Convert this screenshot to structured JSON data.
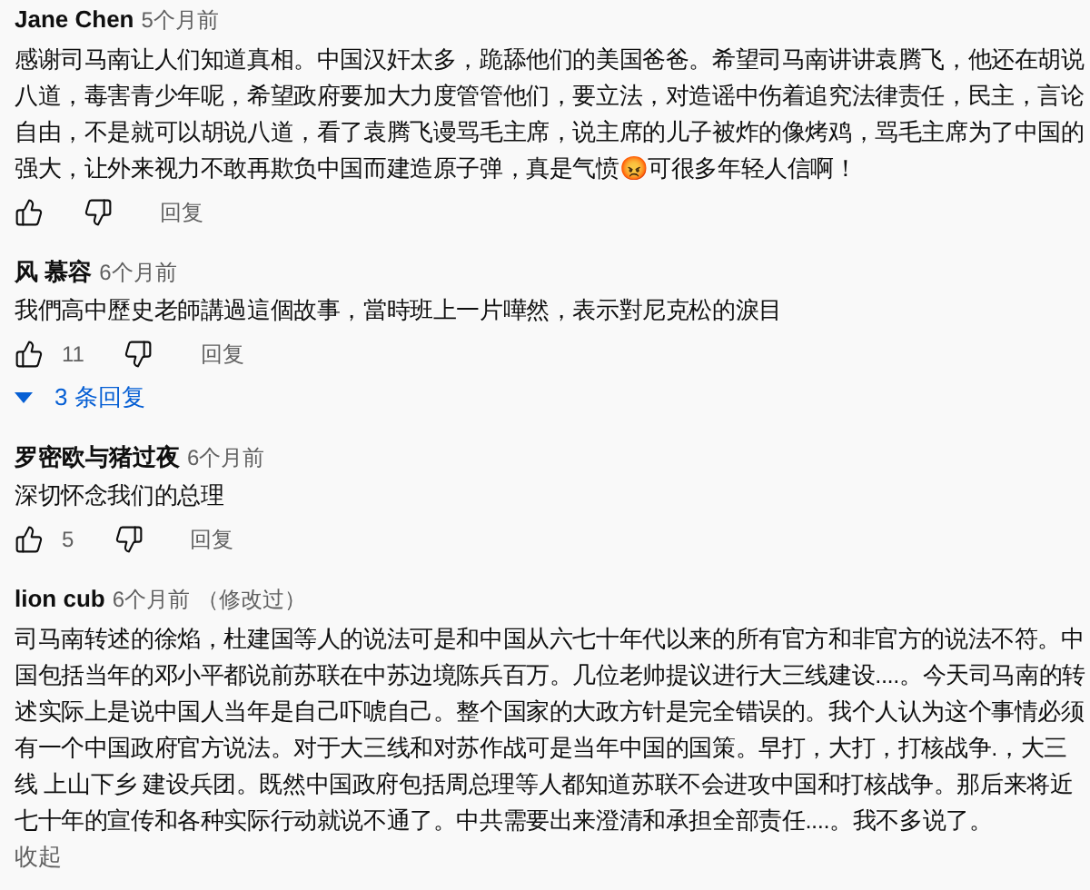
{
  "comments": [
    {
      "author": "Jane Chen",
      "time": "5个月前",
      "text": "感谢司马南让人们知道真相。中国汉奸太多，跪舔他们的美国爸爸。希望司马南讲讲袁腾飞，他还在胡说八道，毒害青少年呢，希望政府要加大力度管管他们，要立法，对造谣中伤着追究法律责任，民主，言论自由，不是就可以胡说八道，看了袁腾飞谩骂毛主席，说主席的儿子被炸的像烤鸡，骂毛主席为了中国的强大，让外来视力不敢再欺负中国而建造原子弹，真是气愤😡可很多年轻人信啊！",
      "reply_label": "回复"
    },
    {
      "author": "风 慕容",
      "time": "6个月前",
      "text": "我們高中歷史老師講過這個故事，當時班上一片嘩然，表示對尼克松的淚目",
      "likes": "11",
      "reply_label": "回复",
      "replies_label": "3 条回复"
    },
    {
      "author": "罗密欧与猪过夜",
      "time": "6个月前",
      "text": "深切怀念我们的总理",
      "likes": "5",
      "reply_label": "回复"
    },
    {
      "author": "lion cub",
      "time": "6个月前",
      "edited": "（修改过）",
      "text": "司马南转述的徐焰，杜建国等人的说法可是和中国从六七十年代以来的所有官方和非官方的说法不符。中国包括当年的邓小平都说前苏联在中苏边境陈兵百万。几位老帅提议进行大三线建设....。今天司马南的转述实际上是说中国人当年是自己吓唬自己。整个国家的大政方针是完全错误的。我个人认为这个事情必须有一个中国政府官方说法。对于大三线和对苏作战可是当年中国的国策。早打，大打，打核战争.，大三线 上山下乡 建设兵团。既然中国政府包括周总理等人都知道苏联不会进攻中国和打核战争。那后来将近七十年的宣传和各种实际行动就说不通了。中共需要出来澄清和承担全部责任....。我不多说了。",
      "collapse_label": "收起"
    }
  ]
}
